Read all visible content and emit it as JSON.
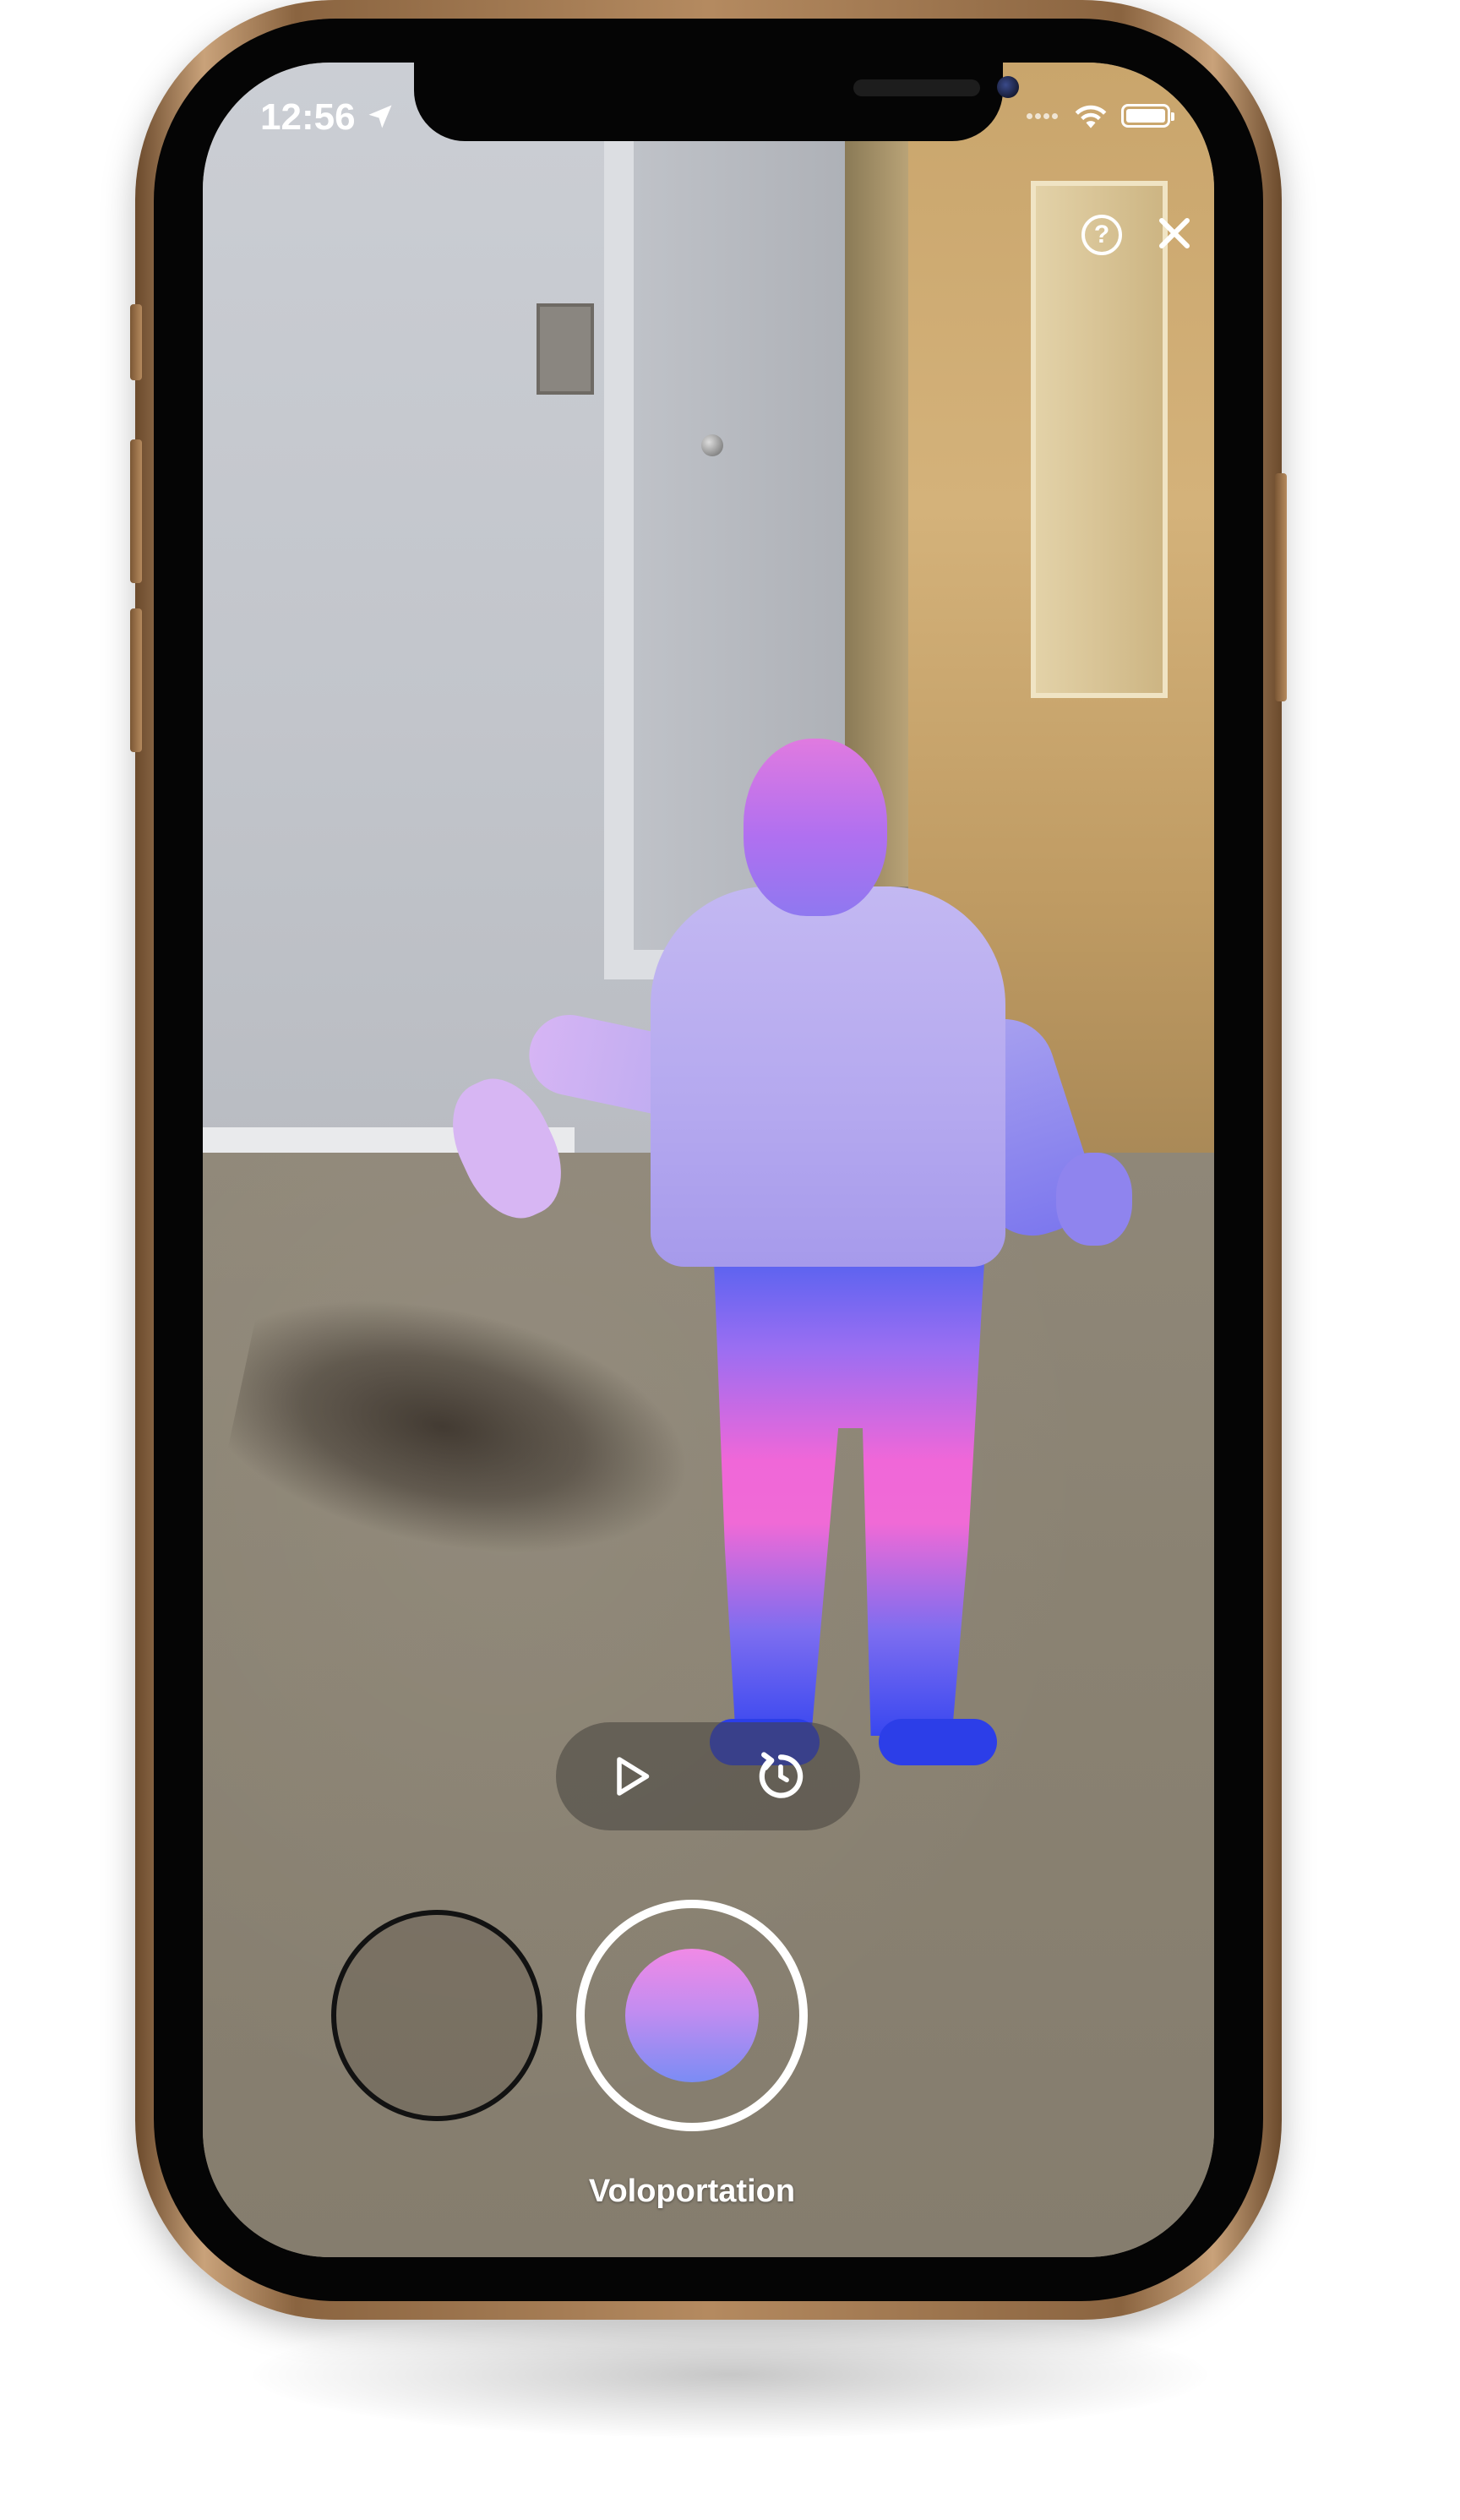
{
  "status_bar": {
    "time": "12:56",
    "location_icon": "location-arrow-icon",
    "wifi_icon": "wifi-icon",
    "battery_icon": "battery-icon"
  },
  "top_controls": {
    "help_icon": "question-circle-icon",
    "help_glyph": "?",
    "close_icon": "close-icon"
  },
  "playback": {
    "play_icon": "play-icon",
    "replay_icon": "replay-icon"
  },
  "capture": {
    "gallery_icon": "gallery-thumbnail",
    "shutter_icon": "capture-button",
    "mode_label": "Voloportation"
  },
  "colors": {
    "hologram_top": "#c3b8f2",
    "hologram_mid": "#f06ad6",
    "hologram_bottom": "#3847f0",
    "device_frame": "#b48a60"
  }
}
